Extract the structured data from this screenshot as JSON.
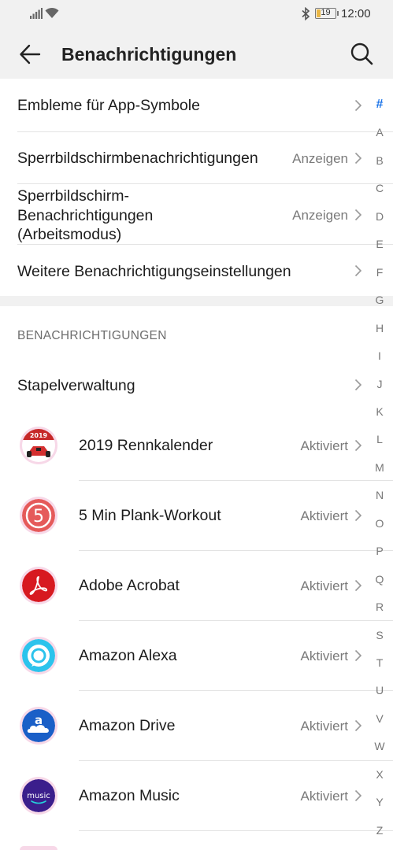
{
  "status_bar": {
    "time": "12:00",
    "battery_level": "19",
    "battery_fraction": 0.19,
    "battery_color": "#e9b645",
    "icons": [
      "signal-icon",
      "wifi-icon",
      "bluetooth-icon",
      "battery-icon"
    ]
  },
  "app_bar": {
    "title": "Benachrichtigungen",
    "back_icon": "arrow-left",
    "search_icon": "magnifier"
  },
  "settings": [
    {
      "label": "Embleme für App-Symbole",
      "value": ""
    },
    {
      "label": "Sperrbildschirmbenachrichtigungen",
      "value": "Anzeigen"
    },
    {
      "label_lines": [
        "Sperrbildschirm-",
        "Benachrichtigungen",
        "(Arbeitsmodus)"
      ],
      "value": "Anzeigen"
    },
    {
      "label": "Weitere Benachrichtigungseinstellungen",
      "value": ""
    }
  ],
  "section_header": "BENACHRICHTIGUNGEN",
  "batch": {
    "label": "Stapelverwaltung"
  },
  "apps": [
    {
      "name": "2019 Rennkalender",
      "status": "Aktiviert",
      "icon": "race-calendar",
      "icon_text": "2019"
    },
    {
      "name": "5 Min Plank-Workout",
      "status": "Aktiviert",
      "icon": "plank-five",
      "icon_text": "5"
    },
    {
      "name": "Adobe Acrobat",
      "status": "Aktiviert",
      "icon": "adobe-acrobat"
    },
    {
      "name": "Amazon Alexa",
      "status": "Aktiviert",
      "icon": "amazon-alexa"
    },
    {
      "name": "Amazon Drive",
      "status": "Aktiviert",
      "icon": "amazon-drive",
      "icon_text": "a"
    },
    {
      "name": "Amazon Music",
      "status": "Aktiviert",
      "icon": "amazon-music",
      "icon_text": "music"
    }
  ],
  "alphabet": [
    "#",
    "A",
    "B",
    "C",
    "D",
    "E",
    "F",
    "G",
    "H",
    "I",
    "J",
    "K",
    "L",
    "M",
    "N",
    "O",
    "P",
    "Q",
    "R",
    "S",
    "T",
    "U",
    "V",
    "W",
    "X",
    "Y",
    "Z"
  ],
  "colors": {
    "accent": "#1a73e8",
    "background": "#f1f1f1",
    "card": "#ffffff"
  }
}
